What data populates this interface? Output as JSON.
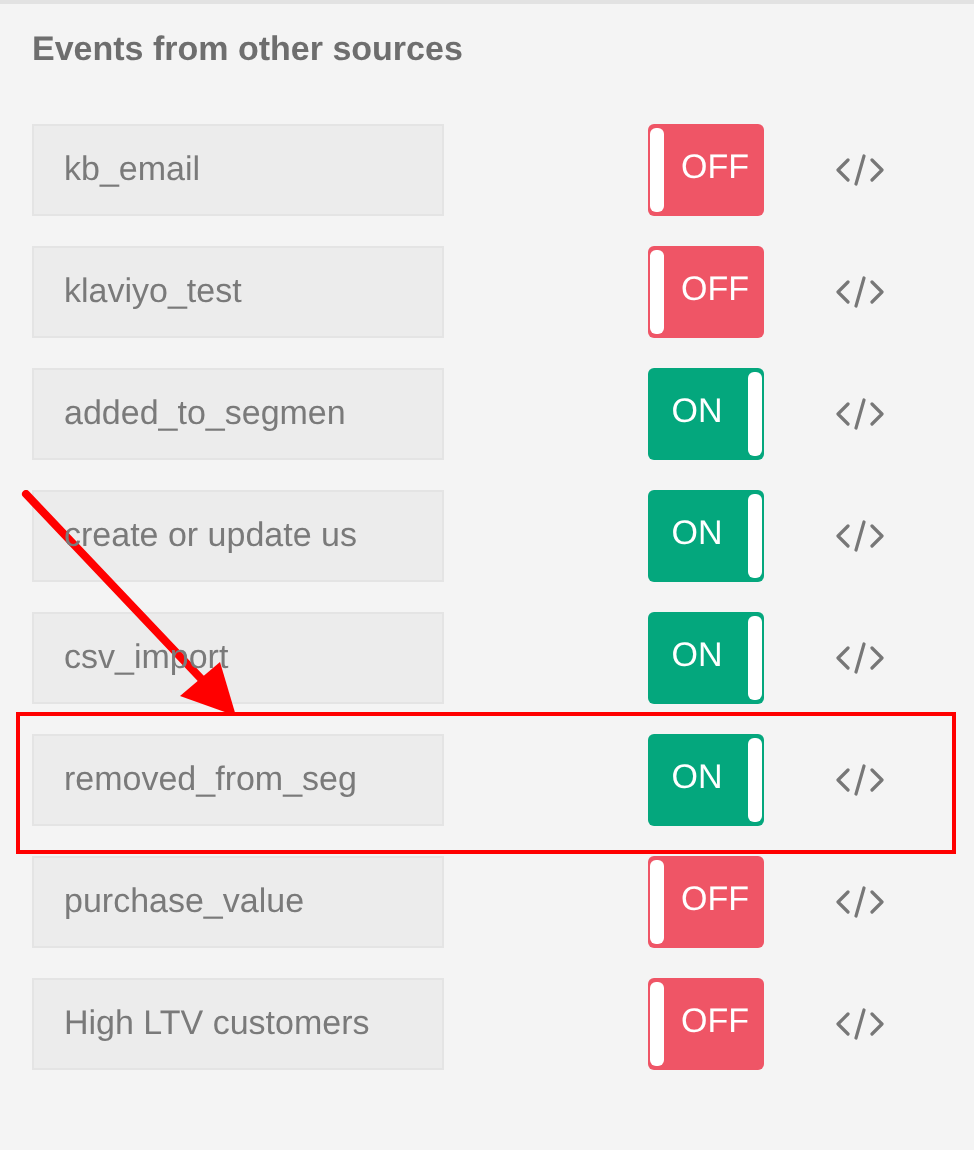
{
  "section": {
    "title": "Events from other sources"
  },
  "events": [
    {
      "name": "kb_email",
      "on": false,
      "toggle_label": "OFF",
      "highlighted": false
    },
    {
      "name": "klaviyo_test",
      "on": false,
      "toggle_label": "OFF",
      "highlighted": false
    },
    {
      "name": "added_to_segmen",
      "on": true,
      "toggle_label": "ON",
      "highlighted": false
    },
    {
      "name": "create or update us",
      "on": true,
      "toggle_label": "ON",
      "highlighted": false
    },
    {
      "name": "csv_import",
      "on": true,
      "toggle_label": "ON",
      "highlighted": false
    },
    {
      "name": "removed_from_seg",
      "on": true,
      "toggle_label": "ON",
      "highlighted": true
    },
    {
      "name": "purchase_value",
      "on": false,
      "toggle_label": "OFF",
      "highlighted": false
    },
    {
      "name": "High LTV customers",
      "on": false,
      "toggle_label": "OFF",
      "highlighted": false
    }
  ]
}
